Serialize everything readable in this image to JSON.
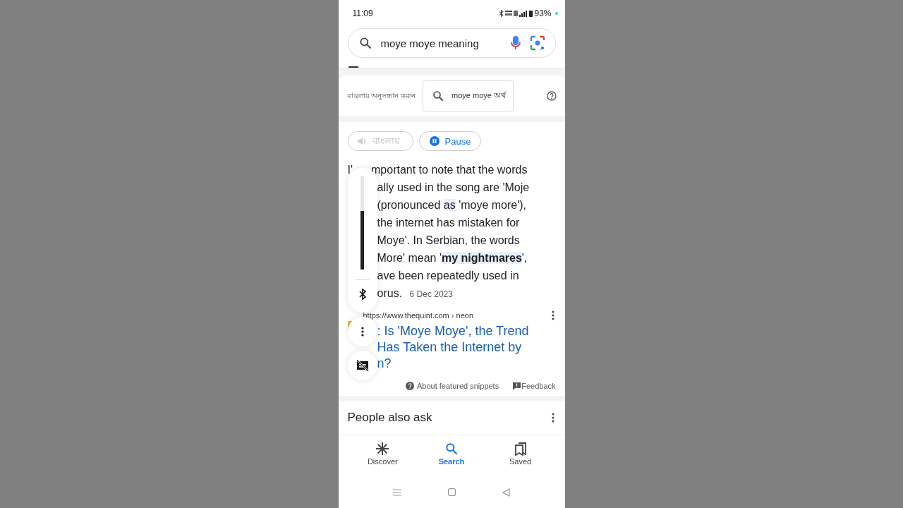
{
  "status_bar": {
    "time": "11:09",
    "battery": "93%"
  },
  "search": {
    "query": "moye moye meaning"
  },
  "language_bar": {
    "label": "বাঙলায় অনুসন্ধান করুন",
    "query": "moye moye অর্থ"
  },
  "audio_buttons": [
    {
      "kind": "speaker",
      "label": "বাংলায়",
      "disabled": true
    },
    {
      "kind": "pause",
      "label": "Pause",
      "disabled": false
    }
  ],
  "snippet": {
    "lead": "I'",
    "lines": [
      [
        {
          "text": "mportant to note that the words",
          "highlight": false
        }
      ],
      [
        {
          "text": "ally used in the song are 'Moje",
          "highlight": false
        }
      ],
      [
        {
          "text": "(pronounced ",
          "highlight": false
        },
        {
          "text": "as",
          "highlight": true
        },
        {
          "text": " 'moye more'),",
          "highlight": false
        }
      ],
      [
        {
          "text": "the internet has mistaken for",
          "highlight": false
        }
      ],
      [
        {
          "text": "Moye'. In Serbian, the words",
          "highlight": false
        }
      ],
      [
        {
          "text": "More' mean '",
          "highlight": false
        },
        {
          "text": "**my nightmares**",
          "highlight": true
        },
        {
          "text": "',",
          "highlight": false
        }
      ],
      [
        {
          "text": "ave been repeatedly used in",
          "highlight": false
        }
      ],
      [
        {
          "text": "orus.",
          "highlight": false
        }
      ]
    ],
    "date": "6 Dec 2023"
  },
  "source": {
    "url": "https://www.thequint.com › neon",
    "title_lines": [
      ": Is 'Moye Moye', the Trend",
      "Has Taken the Internet by",
      "n?"
    ]
  },
  "snippet_footer": {
    "about": "About featured snippets",
    "feedback": "Feedback"
  },
  "people_also_ask": {
    "title": "People also ask"
  },
  "volume_overlay": {
    "level": 0.63
  },
  "bottom_nav": [
    {
      "kind": "discover",
      "label": "Discover",
      "selected": false
    },
    {
      "kind": "search",
      "label": "Search",
      "selected": true
    },
    {
      "kind": "saved",
      "label": "Saved",
      "selected": false
    }
  ]
}
